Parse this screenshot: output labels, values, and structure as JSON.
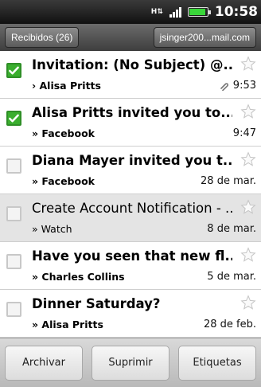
{
  "status_bar": {
    "network_icon": "hspa-icon",
    "network_label": "H",
    "time": "10:58",
    "battery_level": 0.9
  },
  "header": {
    "folder_label": "Recibidos (26)",
    "account_label": "jsinger200...mail.com"
  },
  "messages": [
    {
      "subject": "Invitation: (No Subject) @...",
      "sender": "› Alisa Pritts",
      "date": "9:53",
      "checked": true,
      "unread": true,
      "attachment": true
    },
    {
      "subject": "Alisa Pritts invited you to...",
      "sender": "» Facebook",
      "date": "9:47",
      "checked": true,
      "unread": true,
      "attachment": false
    },
    {
      "subject": "Diana Mayer invited you t...",
      "sender": "» Facebook",
      "date": "28 de mar.",
      "checked": false,
      "unread": true,
      "attachment": false
    },
    {
      "subject": "Create Account Notification - ...",
      "sender": "» Watch",
      "date": "8 de mar.",
      "checked": false,
      "unread": false,
      "attachment": false,
      "highlight": true
    },
    {
      "subject": "Have you seen that new fl...",
      "sender": "» Charles Collins",
      "date": "5 de mar.",
      "checked": false,
      "unread": true,
      "attachment": false
    },
    {
      "subject": "Dinner Saturday?",
      "sender": "» Alisa Pritts",
      "date": "28 de feb.",
      "checked": false,
      "unread": true,
      "attachment": false
    }
  ],
  "bottom_bar": {
    "archive_label": "Archivar",
    "delete_label": "Suprimir",
    "labels_label": "Etiquetas"
  },
  "colors": {
    "check_green": "#3aae2e",
    "battery_green": "#39d639"
  }
}
